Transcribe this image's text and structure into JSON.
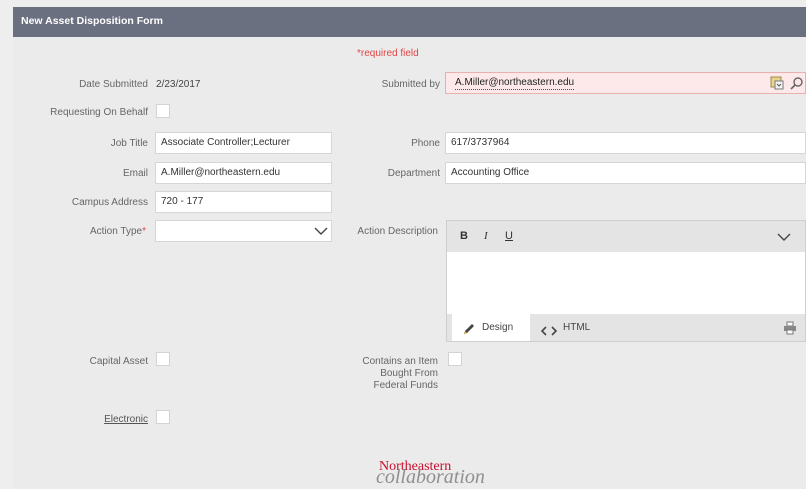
{
  "form": {
    "title": "New Asset Disposition Form",
    "required_note": "*required field"
  },
  "fields": {
    "date_submitted": {
      "label": "Date Submitted",
      "value": "2/23/2017"
    },
    "submitted_by": {
      "label": "Submitted by",
      "value": "A.Miller@northeastern.edu"
    },
    "requesting_on_behalf": {
      "label": "Requesting On Behalf"
    },
    "job_title": {
      "label": "Job Title",
      "value": "Associate Controller;Lecturer"
    },
    "phone": {
      "label": "Phone",
      "value": "617/3737964"
    },
    "email": {
      "label": "Email",
      "value": "A.Miller@northeastern.edu"
    },
    "department": {
      "label": "Department",
      "value": "Accounting Office"
    },
    "campus_address": {
      "label": "Campus Address",
      "value": "720 - 177"
    },
    "action_type": {
      "label": "Action Type",
      "required_mark": "*",
      "value": ""
    },
    "action_description": {
      "label": "Action Description"
    },
    "capital_asset": {
      "label": "Capital Asset"
    },
    "federal_funds": {
      "label_lines": [
        "Contains an Item",
        "Bought From",
        "Federal Funds"
      ]
    },
    "electronic": {
      "label": "Electronic"
    }
  },
  "editor": {
    "bold": "B",
    "italic": "I",
    "underline": "U",
    "design_tab": "Design",
    "html_tab": "HTML"
  },
  "footer": {
    "brand_primary": "Northeastern",
    "brand_secondary": "collaboration"
  }
}
